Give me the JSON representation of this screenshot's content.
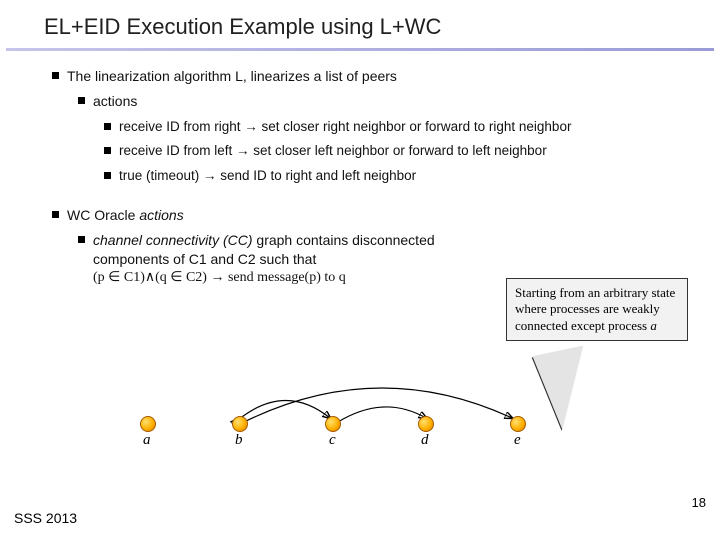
{
  "title": "EL+EID Execution Example using L+WC",
  "bullets": {
    "linearization": "The linearization algorithm L, linearizes a list of peers",
    "actions_label": "actions",
    "a1": "receive ID from right → set closer right neighbor or forward to right neighbor",
    "a2": "receive ID from left →  set closer left neighbor or forward to left neighbor",
    "a3": "true (timeout) → send ID to right and left neighbor",
    "wc_label": "WC Oracle ",
    "wc_actions": "actions",
    "cc_pre": "channel connectivity (CC) ",
    "cc_rest": "graph contains disconnected components of C1 and C2 such that",
    "cc_rule": "(p ∈ C1)∧(q ∈ C2) → send message(p) to q"
  },
  "callout": {
    "l1": "Starting from an arbitrary state where processes are weakly connected except process ",
    "end": "a"
  },
  "nodes": {
    "a": "a",
    "b": "b",
    "c": "c",
    "d": "d",
    "e": "e"
  },
  "footer": "SSS 2013",
  "page": "18"
}
